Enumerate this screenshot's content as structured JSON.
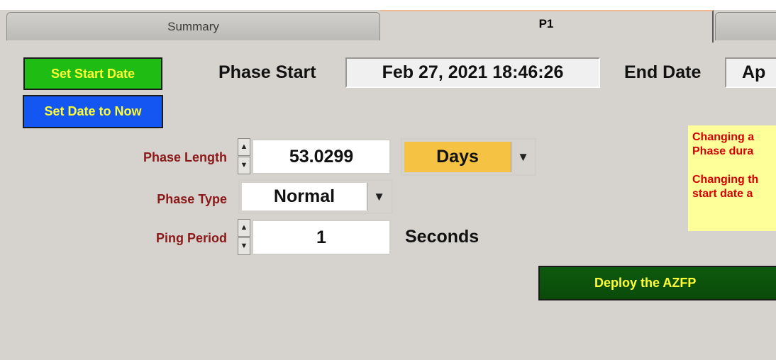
{
  "tabs": {
    "summary": "Summary",
    "p1": "P1"
  },
  "buttons": {
    "set_start_date": "Set Start Date",
    "set_date_now": "Set Date to Now",
    "deploy": "Deploy the AZFP"
  },
  "phase_start": {
    "label": "Phase Start",
    "value": "Feb 27, 2021 18:46:26"
  },
  "end_date": {
    "label": "End Date",
    "value": "Ap"
  },
  "phase_length": {
    "label": "Phase Length",
    "value": "53.0299",
    "unit": "Days"
  },
  "phase_type": {
    "label": "Phase Type",
    "value": "Normal"
  },
  "ping_period": {
    "label": "Ping Period",
    "value": "1",
    "unit": "Seconds"
  },
  "note": {
    "line1": "Changing a",
    "line2": "Phase dura",
    "line3": "",
    "line4": "Changing th",
    "line5": "start date a"
  },
  "colors": {
    "start_button": "#1fbd14",
    "now_button": "#1456f2",
    "deploy_button": "#0e5a0e",
    "button_text": "#ffff33",
    "units_select": "#f5c244",
    "note_background": "#ffff99",
    "note_text": "#d60000",
    "label_red": "#8a1a1a"
  }
}
